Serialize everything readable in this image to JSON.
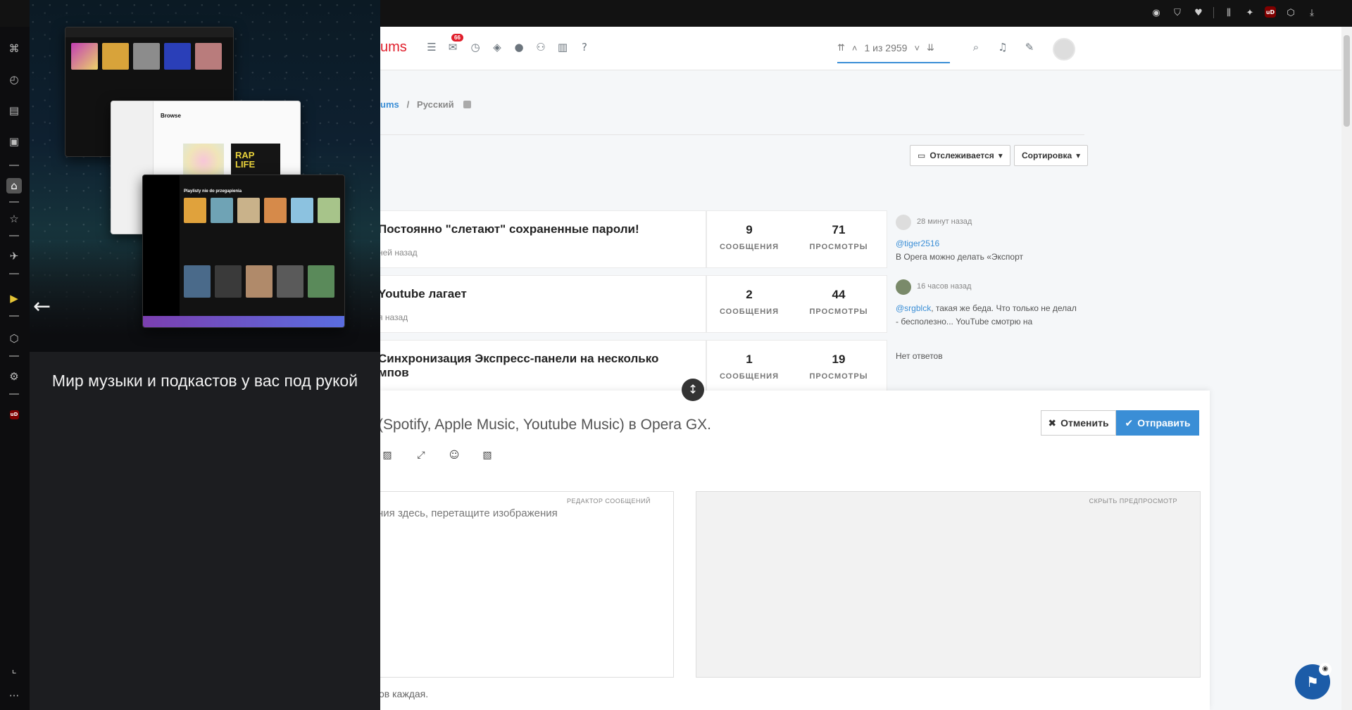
{
  "browser": {
    "extensions": [
      "camera-icon",
      "shield-icon",
      "heart-icon",
      "bookmark-icon",
      "duck-icon",
      "ublock-icon",
      "cube-icon",
      "download-icon"
    ],
    "ublock_label": "uD"
  },
  "gx_sidebar": {
    "items": [
      "gamepad-icon",
      "speedometer-icon",
      "toolbox-icon",
      "twitch-icon",
      "music-player-icon",
      "favorites-icon",
      "twitter-icon",
      "player-icon",
      "cube-icon",
      "settings-icon",
      "ublock-icon",
      "history-icon",
      "more-icon"
    ],
    "ublock_label": "uD",
    "more_label": "···"
  },
  "music_panel": {
    "caption": "Мир музыки и подкастов у вас под рукой",
    "back_arrow": "←",
    "apple_browse_label": "Browse",
    "rap_label": "RAP LIFE",
    "spotify_label": "Playlisty nie do przegapienia"
  },
  "forum": {
    "brand": "ums",
    "notifications_count": "66",
    "pager_text": "1 из 2959",
    "breadcrumb": {
      "parent": "ums",
      "separator": "/",
      "current": "Русский"
    },
    "watch_button": "Отслеживается",
    "sort_button": "Сортировка",
    "topics": [
      {
        "title": "Постоянно \"слетают\" сохраненные пароли!",
        "meta": "ней назад",
        "posts": "9",
        "views": "71",
        "last_time": "28 минут назад",
        "last_user": "@tiger2516",
        "last_text": "В Opera можно делать «Экспорт"
      },
      {
        "title": "Youtube лагает",
        "meta": "я назад",
        "posts": "2",
        "views": "44",
        "last_time": "16 часов назад",
        "last_user": "@srgblck",
        "last_text": ", такая же беда. Что только не делал - бесполезно... YouTube смотрю на"
      },
      {
        "title": "Синхронизация Экспресс-панели на несколько",
        "title2": "мпов",
        "posts": "1",
        "views": "19",
        "last_text": "Нет ответов"
      }
    ],
    "posts_label": "СООБЩЕНИЯ",
    "views_label": "ПРОСМОТРЫ"
  },
  "composer": {
    "title": "(Spotify, Apple Music, Youtube Music) в Opera GX.",
    "cancel": "Отменить",
    "submit": "Отправить",
    "editor_label": "РЕДАКТОР СООБЩЕНИЙ",
    "editor_placeholder": "ния здесь, перетащите изображения",
    "preview_label": "СКРЫТЬ ПРЕДПРОСМОТР",
    "footer_note": "ов каждая."
  },
  "colors": {
    "accent": "#3a8ed6",
    "brand": "#e01e2b",
    "sidebar_bg": "#0d0d0f"
  }
}
